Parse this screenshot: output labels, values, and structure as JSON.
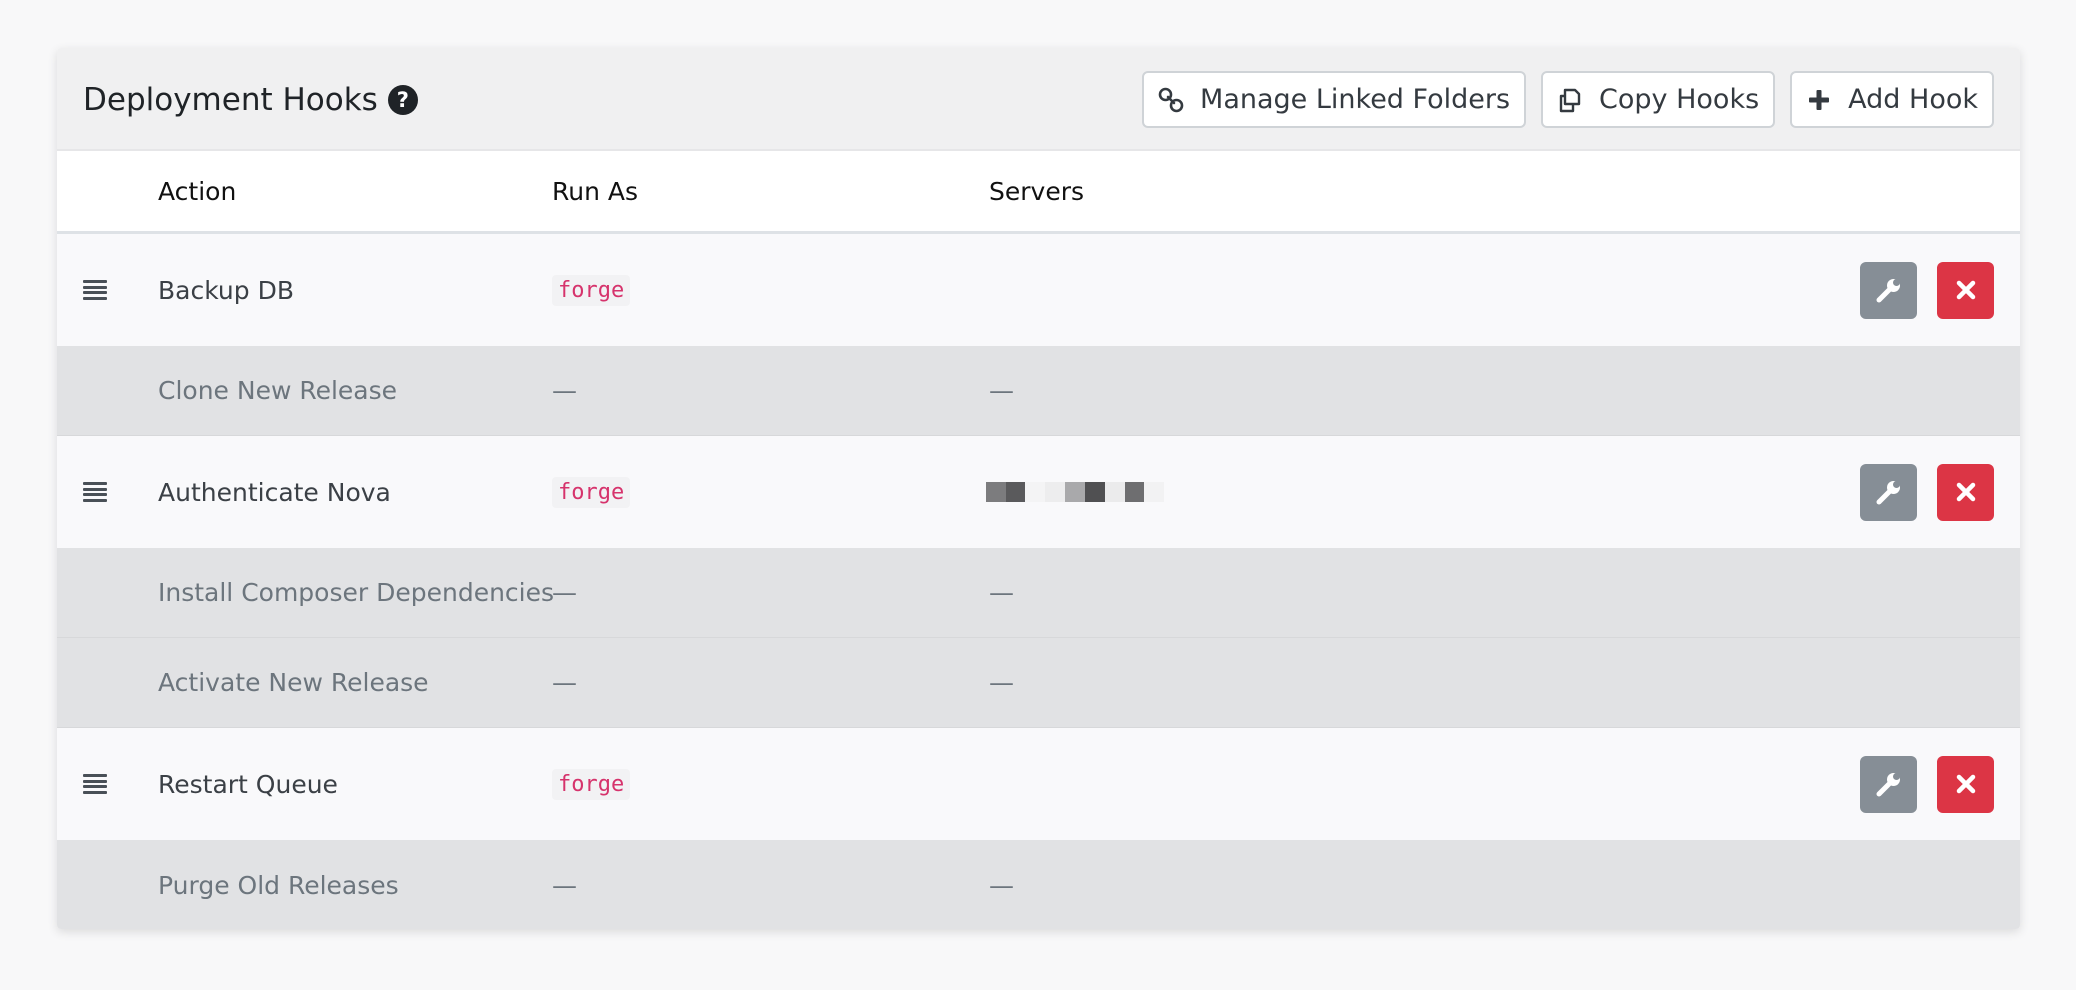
{
  "header": {
    "title": "Deployment Hooks",
    "help_glyph": "?",
    "buttons": {
      "manage_linked_folders": "Manage Linked Folders",
      "copy_hooks": "Copy Hooks",
      "add_hook": "Add Hook"
    }
  },
  "columns": {
    "action": "Action",
    "run_as": "Run As",
    "servers": "Servers"
  },
  "hooks": [
    {
      "action": "Backup DB",
      "run_as": "forge",
      "servers": "",
      "type": "custom"
    },
    {
      "action": "Clone New Release",
      "run_as": "—",
      "servers": "—",
      "type": "builtin"
    },
    {
      "action": "Authenticate Nova",
      "run_as": "forge",
      "servers": "[redacted]",
      "type": "custom"
    },
    {
      "action": "Install Composer Dependencies",
      "run_as": "—",
      "servers": "—",
      "type": "builtin"
    },
    {
      "action": "Activate New Release",
      "run_as": "—",
      "servers": "—",
      "type": "builtin"
    },
    {
      "action": "Restart Queue",
      "run_as": "forge",
      "servers": "",
      "type": "custom"
    },
    {
      "action": "Purge Old Releases",
      "run_as": "—",
      "servers": "—",
      "type": "builtin"
    }
  ],
  "icons": {
    "help": "question-circle-icon",
    "link": "link-icon",
    "copy": "copy-icon",
    "plus": "plus-icon",
    "drag": "drag-handle-icon",
    "edit": "wrench-icon",
    "delete": "close-icon"
  },
  "colors": {
    "edit_button": "#868e96",
    "delete_button": "#dc3545",
    "code_text": "#d6336c",
    "builtin_row_bg": "#e1e2e4"
  }
}
